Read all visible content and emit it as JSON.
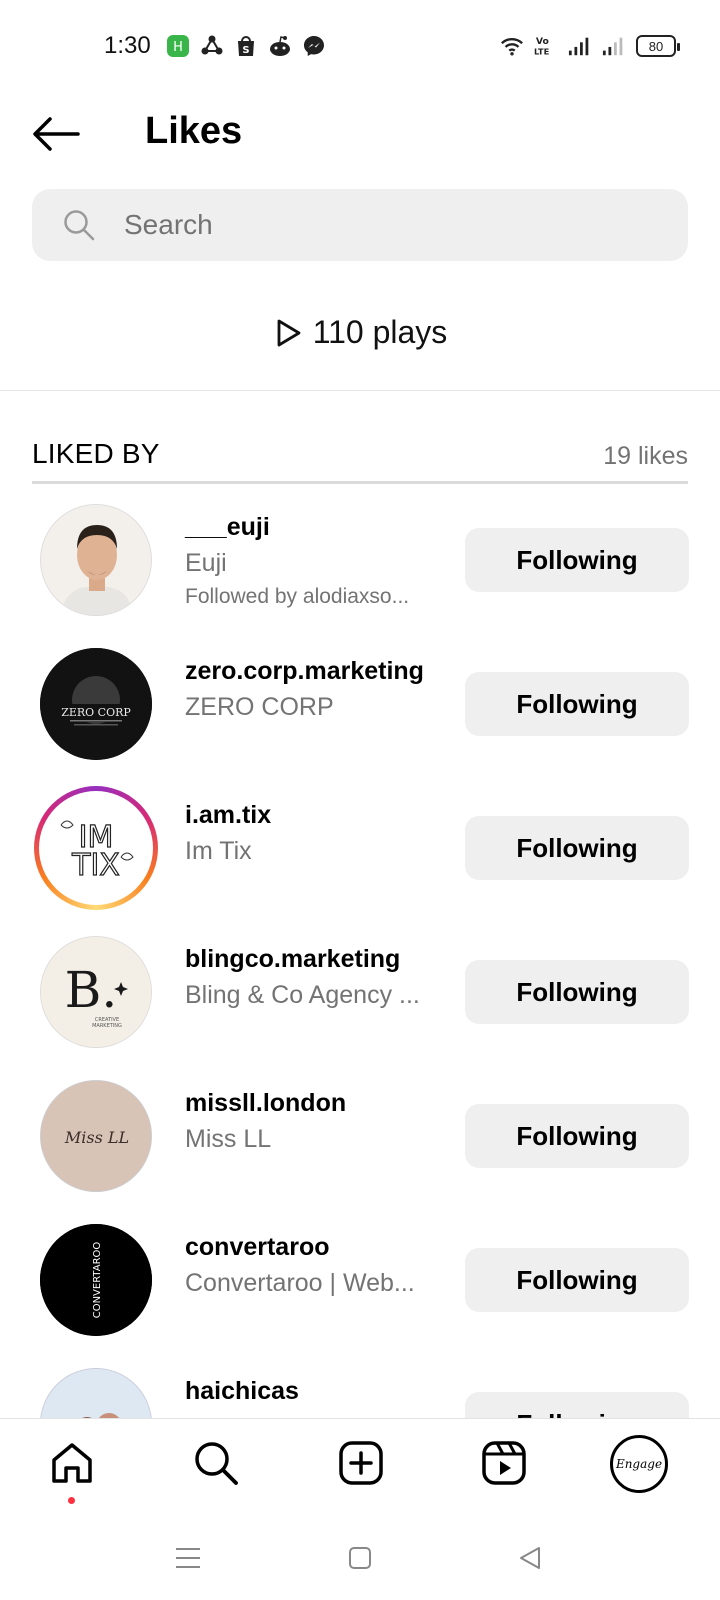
{
  "status_bar": {
    "time": "1:30",
    "battery": "80",
    "volte": "Vo\nLTE",
    "icons_left": [
      "app-icon",
      "sync-icon",
      "shop-icon",
      "reddit-icon",
      "messenger-icon"
    ],
    "icons_right": [
      "wifi-icon",
      "volte-icon",
      "signal-icon",
      "signal-icon",
      "battery-icon"
    ]
  },
  "header": {
    "title": "Likes"
  },
  "search": {
    "placeholder": "Search",
    "value": ""
  },
  "plays": {
    "label": "110 plays"
  },
  "liked_by": {
    "title": "LIKED BY",
    "count": "19 likes"
  },
  "users": [
    {
      "username": "___euji",
      "fullname": "Euji",
      "followed_by": "Followed by alodiaxso...",
      "button": "Following",
      "avatar": "photo-man",
      "avatar_bg": "#f1ede8"
    },
    {
      "username": "zero.corp.marketing",
      "fullname": "ZERO CORP",
      "followed_by": "",
      "button": "Following",
      "avatar": "ZERO CORP",
      "avatar_bg": "#111111"
    },
    {
      "username": "i.am.tix",
      "fullname": "Im Tix",
      "followed_by": "",
      "button": "Following",
      "avatar": "IM TIX",
      "avatar_bg": "#ffffff"
    },
    {
      "username": "blingco.marketing",
      "fullname": "Bling & Co Agency ...",
      "followed_by": "",
      "button": "Following",
      "avatar": "B.",
      "avatar_bg": "#f4efe6"
    },
    {
      "username": "missll.london",
      "fullname": "Miss LL",
      "followed_by": "",
      "button": "Following",
      "avatar": "Miss LL",
      "avatar_bg": "#d8c3b7"
    },
    {
      "username": "convertaroo",
      "fullname": "Convertaroo | Web...",
      "followed_by": "",
      "button": "Following",
      "avatar": "CONVERTAROO",
      "avatar_bg": "#000000"
    },
    {
      "username": "haichicas",
      "fullname": "",
      "followed_by": "",
      "button": "Following",
      "avatar": "illustration",
      "avatar_bg": "#dde8f2"
    }
  ],
  "bottom_nav": {
    "items": [
      "home-icon",
      "search-icon",
      "create-icon",
      "reels-icon",
      "profile-avatar"
    ],
    "profile_text": "Engage",
    "notification_color": "#ff3040"
  },
  "system_nav": {
    "items": [
      "menu-icon",
      "home-square-icon",
      "back-triangle-icon"
    ]
  },
  "colors": {
    "button_bg": "#efefef",
    "secondary_text": "#737373",
    "story_ring": [
      "#feda75",
      "#fa7e1e",
      "#d62976",
      "#962fbf"
    ]
  }
}
